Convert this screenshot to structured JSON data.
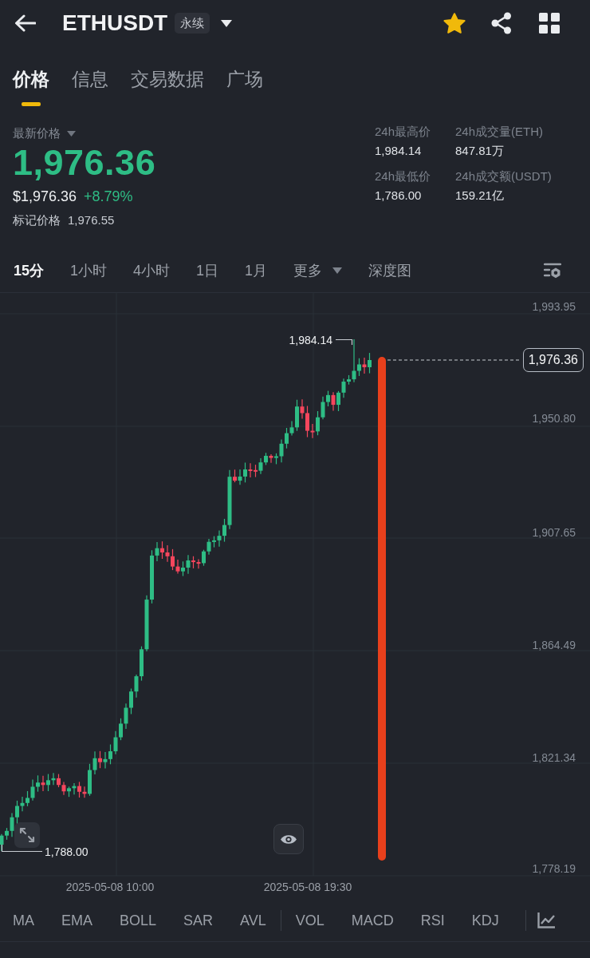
{
  "header": {
    "symbol": "ETHUSDT",
    "contract_type": "永续",
    "favorited": true
  },
  "tabs": [
    {
      "label": "价格",
      "selected": true
    },
    {
      "label": "信息",
      "selected": false
    },
    {
      "label": "交易数据",
      "selected": false
    },
    {
      "label": "广场",
      "selected": false
    }
  ],
  "price": {
    "label": "最新价格",
    "last": "1,976.36",
    "rising": true,
    "usd": "$1,976.36",
    "change": "+8.79%",
    "mark_label": "标记价格",
    "mark_value": "1,976.55"
  },
  "stats_24h": [
    {
      "label": "24h最高价",
      "value": "1,984.14"
    },
    {
      "label": "24h成交量(ETH)",
      "value": "847.81万"
    },
    {
      "label": "24h最低价",
      "value": "1,786.00"
    },
    {
      "label": "24h成交额(USDT)",
      "value": "159.21亿"
    }
  ],
  "intervals": [
    {
      "label": "15分",
      "kind": "interval",
      "selected": true
    },
    {
      "label": "1小时",
      "kind": "interval",
      "selected": false
    },
    {
      "label": "4小时",
      "kind": "interval",
      "selected": false
    },
    {
      "label": "1日",
      "kind": "interval",
      "selected": false
    },
    {
      "label": "1月",
      "kind": "interval",
      "selected": false
    },
    {
      "label": "更多",
      "kind": "dropdown",
      "selected": false
    },
    {
      "label": "深度图",
      "kind": "interval",
      "selected": false
    }
  ],
  "chart": {
    "price_axis": [
      "1,993.95",
      "1,950.80",
      "1,907.65",
      "1,864.49",
      "1,821.34",
      "1,778.19"
    ],
    "time_axis": [
      "2025-05-08 10:00",
      "2025-05-08 19:30"
    ],
    "high_label": "1,984.14",
    "low_label": "1,788.00",
    "current_price": "1,976.36"
  },
  "indicators": {
    "main": [
      "MA",
      "EMA",
      "BOLL",
      "SAR",
      "AVL"
    ],
    "sub": [
      "VOL",
      "MACD",
      "RSI",
      "KDJ"
    ]
  }
}
